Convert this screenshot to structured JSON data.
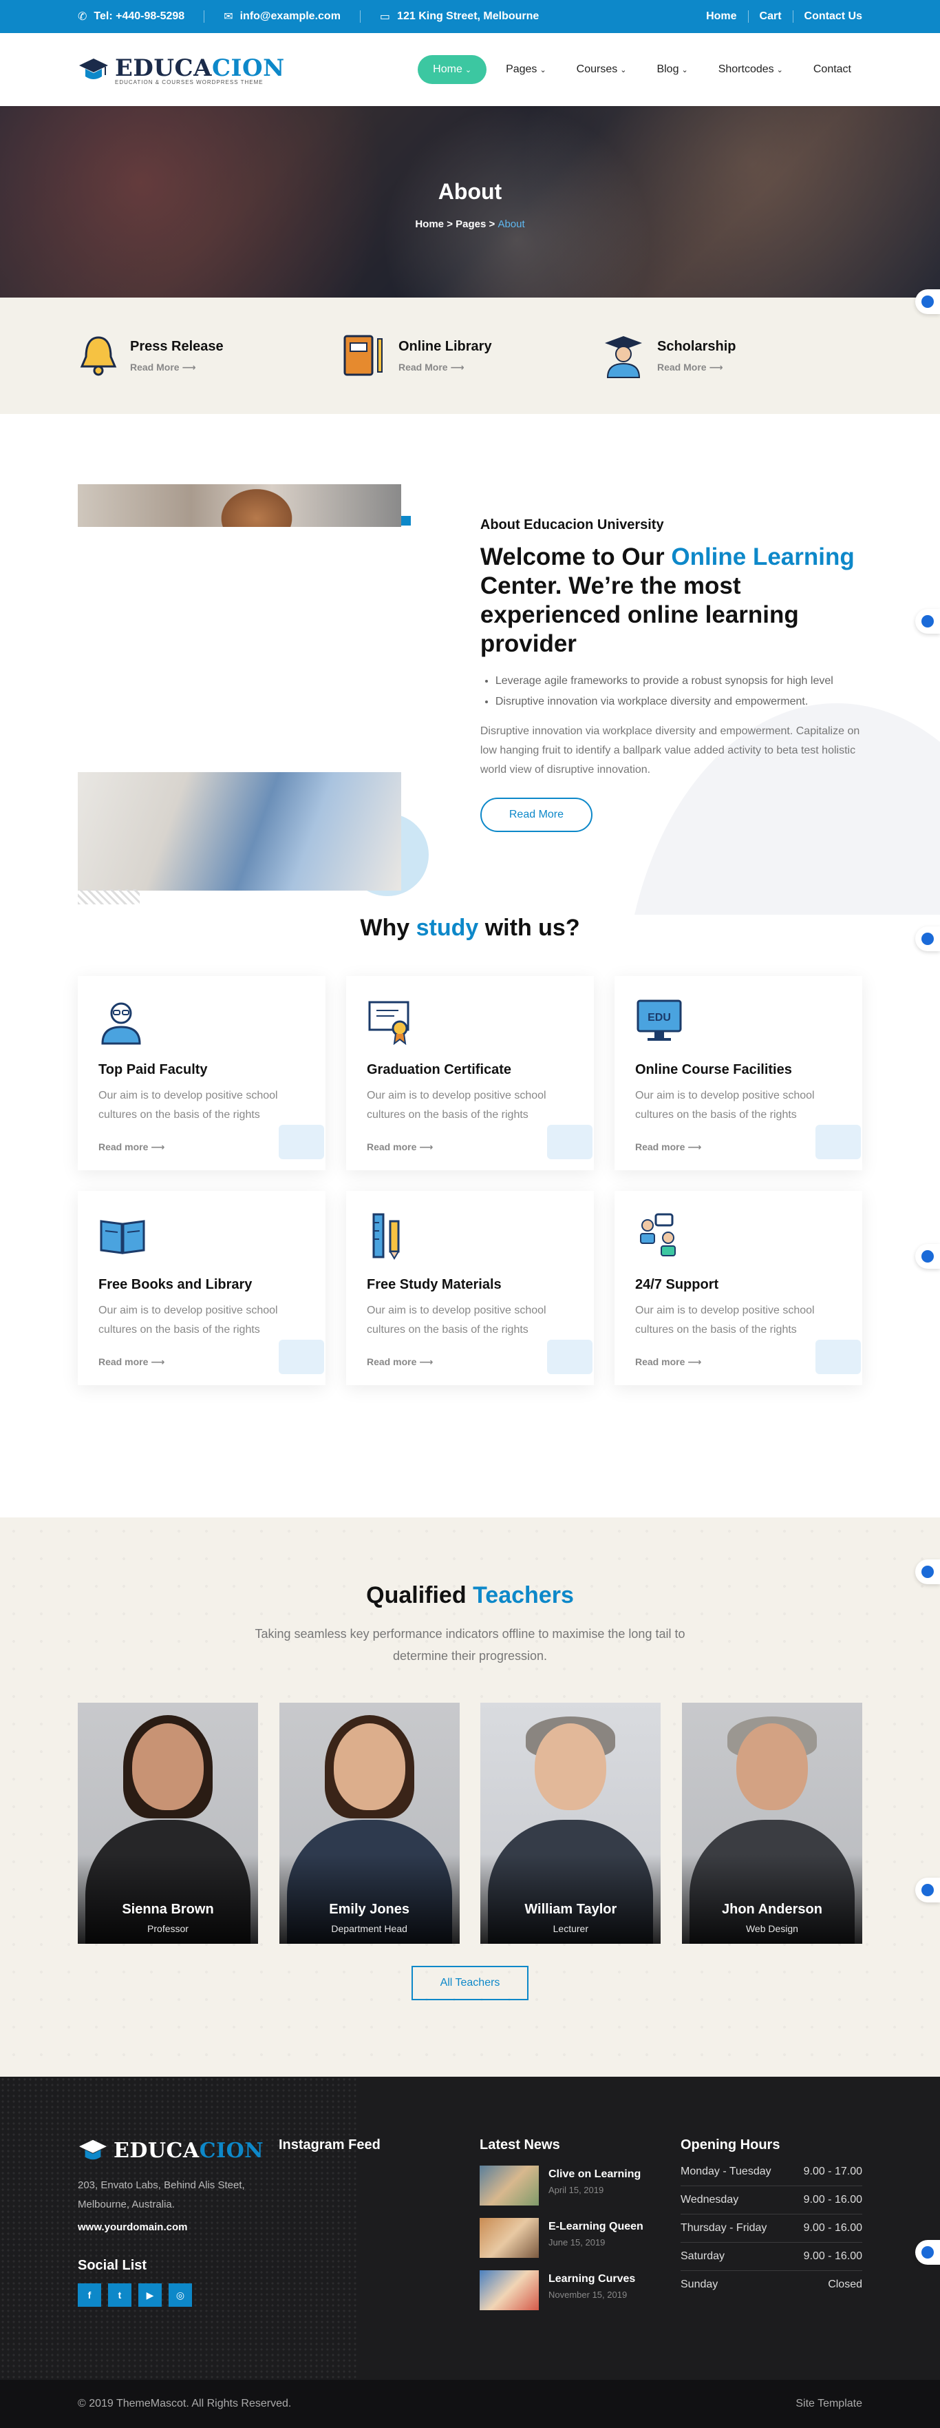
{
  "topbar": {
    "phone": "Tel: +440-98-5298",
    "email": "info@example.com",
    "address": "121 King Street, Melbourne",
    "links": [
      "Home",
      "Cart",
      "Contact Us"
    ]
  },
  "header": {
    "logo_a": "EDUCA",
    "logo_b": "CION",
    "logo_sub": "EDUCATION & COURSES WORDPRESS THEME",
    "nav": [
      {
        "label": "Home",
        "dropdown": true,
        "active": true
      },
      {
        "label": "Pages",
        "dropdown": true
      },
      {
        "label": "Courses",
        "dropdown": true
      },
      {
        "label": "Blog",
        "dropdown": true
      },
      {
        "label": "Shortcodes",
        "dropdown": true
      },
      {
        "label": "Contact",
        "dropdown": false
      }
    ]
  },
  "hero": {
    "title": "About",
    "crumb_home": "Home",
    "crumb_pages": "Pages",
    "crumb_current": "About"
  },
  "features": [
    {
      "title": "Press Release",
      "link": "Read More",
      "icon": "bell-icon"
    },
    {
      "title": "Online Library",
      "link": "Read More",
      "icon": "book-icon"
    },
    {
      "title": "Scholarship",
      "link": "Read More",
      "icon": "graduate-icon"
    }
  ],
  "about": {
    "eyebrow": "About Educacion University",
    "heading_pre": "Welcome to Our ",
    "heading_hl": "Online Learning",
    "heading_post": " Center. We’re the most experienced online learning provider",
    "bullets": [
      "Leverage agile frameworks to provide a robust synopsis for high level",
      "Disruptive innovation via workplace diversity and empowerment."
    ],
    "paragraph": "Disruptive innovation via workplace diversity and empowerment. Capitalize on low hanging fruit to identify a ballpark value added activity to beta test holistic world view of disruptive innovation.",
    "button": "Read More"
  },
  "why": {
    "title_pre": "Why ",
    "title_hl": "study",
    "title_post": " with us?",
    "cards": [
      {
        "title": "Top Paid Faculty",
        "text": "Our aim is to develop positive school cultures on the basis of the rights",
        "link": "Read more",
        "icon": "professor-icon"
      },
      {
        "title": "Graduation Certificate",
        "text": "Our aim is to develop positive school cultures on the basis of the rights",
        "link": "Read more",
        "icon": "certificate-icon"
      },
      {
        "title": "Online Course Facilities",
        "text": "Our aim is to develop positive school cultures on the basis of the rights",
        "link": "Read more",
        "icon": "edu-monitor-icon"
      },
      {
        "title": "Free Books and Library",
        "text": "Our aim is to develop positive school cultures on the basis of the rights",
        "link": "Read more",
        "icon": "open-book-icon"
      },
      {
        "title": "Free Study Materials",
        "text": "Our aim is to develop positive school cultures on the basis of the rights",
        "link": "Read more",
        "icon": "ruler-pencil-icon"
      },
      {
        "title": "24/7 Support",
        "text": "Our aim is to develop positive school cultures on the basis of the rights",
        "link": "Read more",
        "icon": "support-icon"
      }
    ]
  },
  "teachers": {
    "title_pre": "Qualified ",
    "title_hl": "Teachers",
    "subtitle": "Taking seamless key performance indicators offline to maximise the long tail to determine their progression.",
    "list": [
      {
        "name": "Sienna Brown",
        "role": "Professor"
      },
      {
        "name": "Emily Jones",
        "role": "Department Head"
      },
      {
        "name": "William Taylor",
        "role": "Lecturer"
      },
      {
        "name": "Jhon Anderson",
        "role": "Web Design"
      }
    ],
    "button": "All Teachers"
  },
  "footer": {
    "address": "203, Envato Labs, Behind Alis Steet, Melbourne, Australia.",
    "website": "www.yourdomain.com",
    "social_title": "Social List",
    "socials": [
      "f",
      "t",
      "▶",
      "◎"
    ],
    "instagram_title": "Instagram Feed",
    "news_title": "Latest News",
    "news": [
      {
        "title": "Clive on Learning",
        "date": "April 15, 2019"
      },
      {
        "title": "E-Learning Queen",
        "date": "June 15, 2019"
      },
      {
        "title": "Learning Curves",
        "date": "November 15, 2019"
      }
    ],
    "hours_title": "Opening Hours",
    "hours": [
      {
        "day": "Monday - Tuesday",
        "time": "9.00 - 17.00"
      },
      {
        "day": "Wednesday",
        "time": "9.00 - 16.00"
      },
      {
        "day": "Thursday - Friday",
        "time": "9.00 - 16.00"
      },
      {
        "day": "Saturday",
        "time": "9.00 - 16.00"
      },
      {
        "day": "Sunday",
        "time": "Closed"
      }
    ],
    "copyright": "© 2019 ThemeMascot. All Rights Reserved.",
    "credit": "Site Template"
  },
  "colors": {
    "primary": "#0d88c9",
    "accent": "#3cc7a1",
    "dark": "#1c1c1e"
  }
}
